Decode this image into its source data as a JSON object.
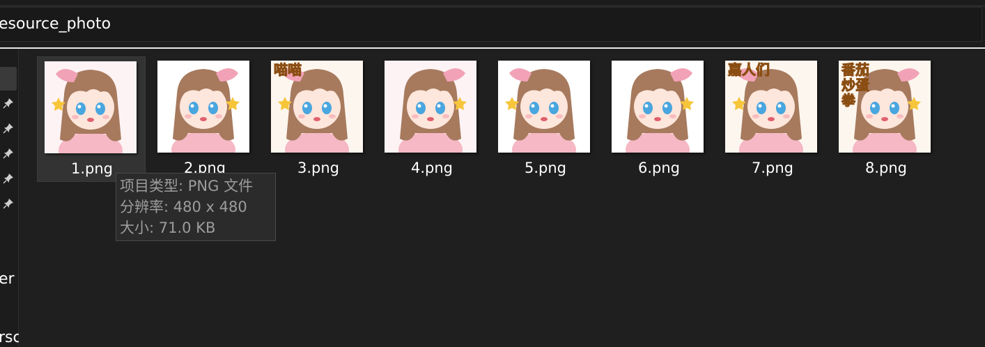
{
  "address_bar": {
    "path": "esource_photo"
  },
  "sidebar": {
    "fragments": [
      "er",
      "rsc"
    ]
  },
  "files": [
    {
      "name": "1.png",
      "overlay_text": "",
      "bg": "#fdf3f5",
      "selected": true
    },
    {
      "name": "2.png",
      "overlay_text": "",
      "bg": "#ffffff",
      "selected": false
    },
    {
      "name": "3.png",
      "overlay_text": "喵喵",
      "bg": "#fdf6ee",
      "selected": false
    },
    {
      "name": "4.png",
      "overlay_text": "",
      "bg": "#fdf3f5",
      "selected": false
    },
    {
      "name": "5.png",
      "overlay_text": "",
      "bg": "#ffffff",
      "selected": false
    },
    {
      "name": "6.png",
      "overlay_text": "",
      "bg": "#ffffff",
      "selected": false
    },
    {
      "name": "7.png",
      "overlay_text": "嘉人们",
      "bg": "#fdf6ee",
      "selected": false
    },
    {
      "name": "8.png",
      "overlay_text": "番茄炒蛋拳",
      "bg": "#fdf6ee",
      "selected": false
    }
  ],
  "tooltip": {
    "type_line": "项目类型: PNG 文件",
    "resolution_line": "分辨率: 480 x 480",
    "size_line": "大小: 71.0 KB"
  },
  "colors": {
    "background": "#1f1f1f",
    "selection": "#333333",
    "tooltip_bg": "#2b2b2b",
    "tooltip_text": "#9d9d9d",
    "hair": "#a77a5e",
    "bow": "#f2a2b6",
    "eyes": "#49a6df",
    "sticker_text": "#f6b23a"
  }
}
